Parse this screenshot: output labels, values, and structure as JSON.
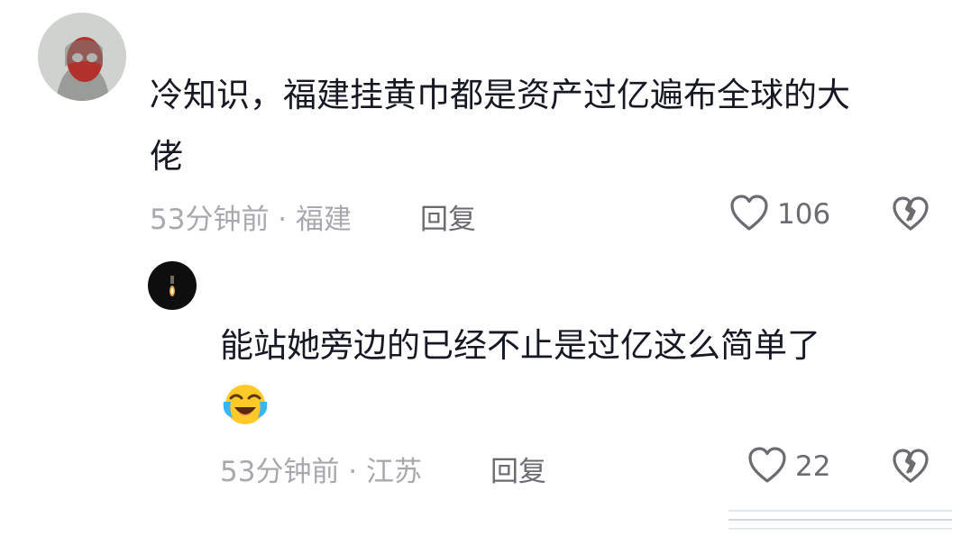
{
  "comments": [
    {
      "text_line1": "冷知识，福建挂黄巾都是资产过亿遍布全球的大",
      "text_line2": "佬",
      "time": "53分钟前 · 福建",
      "reply_label": "回复",
      "likes": "106"
    },
    {
      "text_line1": "能站她旁边的已经不止是过亿这么简单了",
      "time": "53分钟前 · 江苏",
      "reply_label": "回复",
      "likes": "22"
    }
  ],
  "icons": {
    "like": "heart-outline-icon",
    "dislike": "broken-heart-icon",
    "emoji": "crying-laughing-emoji"
  },
  "colors": {
    "text": "#161823",
    "meta": "#a9a9ad",
    "action": "#6b6b70"
  }
}
